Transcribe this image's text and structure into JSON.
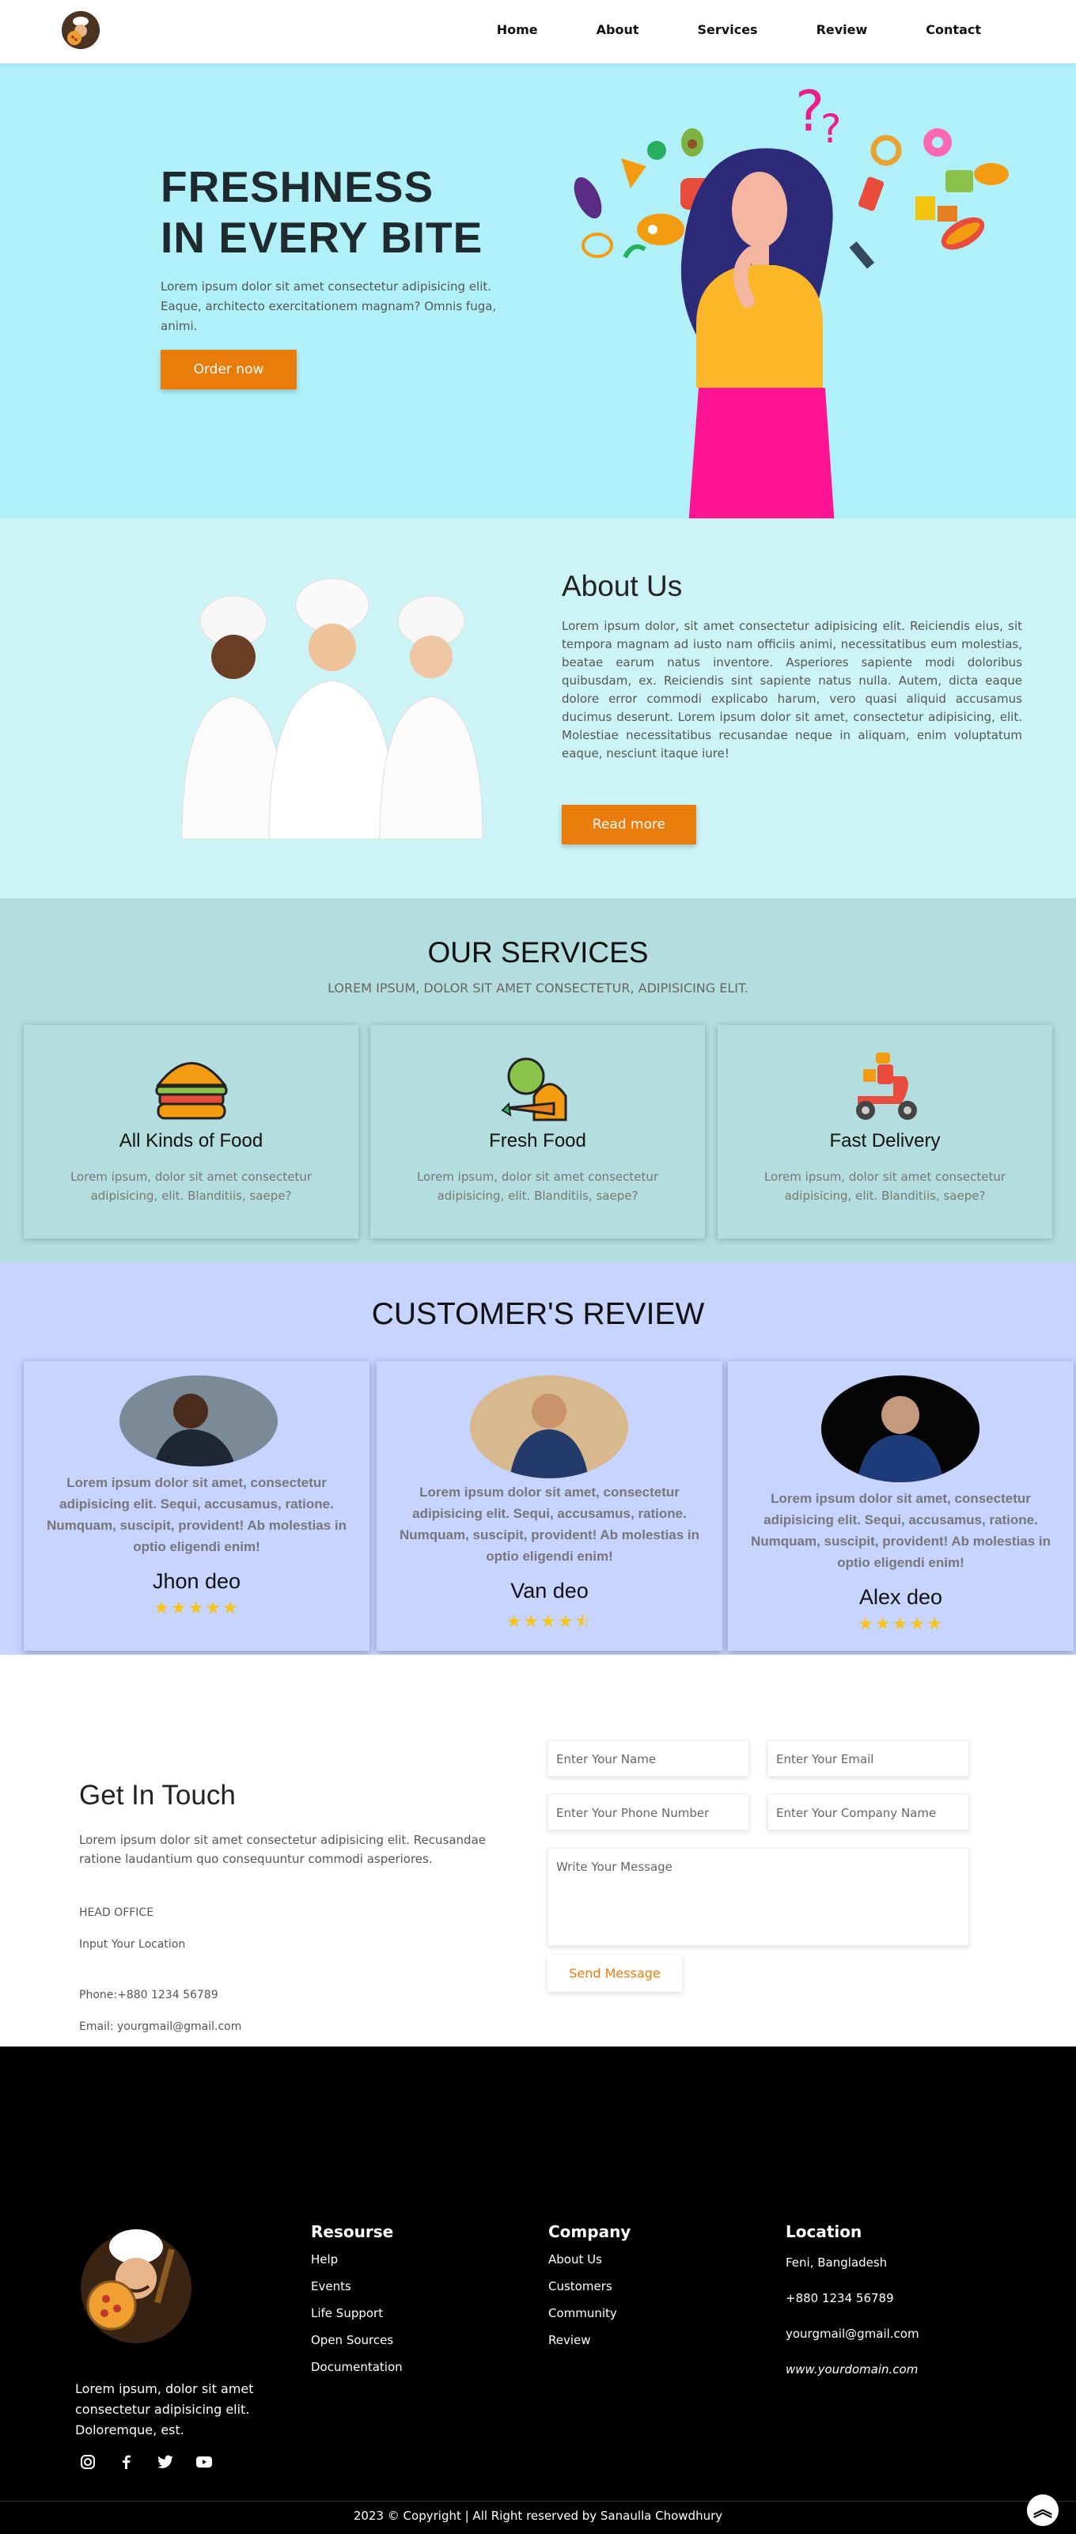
{
  "nav": {
    "logo": "chef-logo",
    "items": [
      {
        "label": "Home"
      },
      {
        "label": "About"
      },
      {
        "label": "Services"
      },
      {
        "label": "Review"
      },
      {
        "label": "Contact"
      }
    ]
  },
  "hero": {
    "title_line1": "FRESHNESS",
    "title_line2": "IN EVERY BITE",
    "text": "Lorem ipsum dolor sit amet consectetur adipisicing elit. Eaque, architecto exercitationem magnam? Omnis fuga, animi.",
    "button": "Order now",
    "bg_color": "#b0f1f9",
    "accent": "#ea7c0c"
  },
  "about": {
    "title": "About Us",
    "text": "Lorem ipsum dolor, sit amet consectetur adipisicing elit. Reiciendis eius, sit tempora magnam ad iusto nam officiis animi, necessitatibus eum molestias, beatae earum natus inventore. Asperiores sapiente modi doloribus quibusdam, ex. Reiciendis sint sapiente natus nulla. Autem, dicta eaque dolore error commodi explicabo harum, vero quasi aliquid accusamus ducimus deserunt. Lorem ipsum dolor sit amet, consectetur adipisicing, elit. Molestiae necessitatibus recusandae neque in aliquam, enim voluptatum eaque, nesciunt itaque iure!",
    "button": "Read more"
  },
  "services": {
    "title": "OUR SERVICES",
    "subtitle": "LOREM IPSUM, DOLOR SIT AMET CONSECTETUR, ADIPISICING ELIT.",
    "cards": [
      {
        "title": "All Kinds of Food",
        "icon": "burger-icon",
        "text": "Lorem ipsum, dolor sit amet consectetur adipisicing, elit. Blanditiis, saepe?"
      },
      {
        "title": "Fresh Food",
        "icon": "vegetables-icon",
        "text": "Lorem ipsum, dolor sit amet consectetur adipisicing, elit. Blanditiis, saepe?"
      },
      {
        "title": "Fast Delivery",
        "icon": "delivery-scooter-icon",
        "text": "Lorem ipsum, dolor sit amet consectetur adipisicing, elit. Blanditiis, saepe?"
      }
    ]
  },
  "reviews": {
    "title": "CUSTOMER'S REVIEW",
    "cards": [
      {
        "quote": "Lorem ipsum dolor sit amet, consectetur adipisicing elit. Sequi, accusamus, ratione. Numquam, suscipit, provident! Ab molestias in optio eligendi enim!",
        "name": "Jhon deo",
        "stars": "★★★★★",
        "rating": 5
      },
      {
        "quote": "Lorem ipsum dolor sit amet, consectetur adipisicing elit. Sequi, accusamus, ratione. Numquam, suscipit, provident! Ab molestias in optio eligendi enim!",
        "name": "Van deo",
        "stars": "★★★★⯪",
        "rating": 4.5
      },
      {
        "quote": "Lorem ipsum dolor sit amet, consectetur adipisicing elit. Sequi, accusamus, ratione. Numquam, suscipit, provident! Ab molestias in optio eligendi enim!",
        "name": "Alex deo",
        "stars": "★★★★★",
        "rating": 5
      }
    ]
  },
  "contact": {
    "title": "Get In Touch",
    "text": "Lorem ipsum dolor sit amet consectetur adipisicing elit. Recusandae ratione laudantium quo consequuntur commodi asperiores.",
    "head_office": "HEAD OFFICE",
    "location": "Input Your Location",
    "phone": "Phone:+880 1234 56789",
    "email": "Email: yourgmail@gmail.com",
    "form": {
      "name_placeholder": "Enter Your Name",
      "email_placeholder": "Enter Your Email",
      "phone_placeholder": "Enter Your Phone Number",
      "company_placeholder": "Enter Your Company Name",
      "message_placeholder": "Write Your Message",
      "send": "Send Message"
    }
  },
  "footer": {
    "about": "Lorem ipsum, dolor sit amet consectetur adipisicing elit. Doloremque, est.",
    "resource": {
      "title": "Resourse",
      "links": [
        "Help",
        "Events",
        "Life Support",
        "Open Sources",
        "Documentation"
      ]
    },
    "company": {
      "title": "Company",
      "links": [
        "About Us",
        "Customers",
        "Community",
        "Review"
      ]
    },
    "location": {
      "title": "Location",
      "lines": [
        "Feni, Bangladesh",
        "+880 1234 56789",
        "yourgmail@gmail.com",
        "www.yourdomain.com"
      ]
    },
    "copyright": "2023 © Copyright | All Right reserved by Sanaulla Chowdhury",
    "social": [
      "instagram-icon",
      "facebook-icon",
      "twitter-icon",
      "youtube-icon"
    ]
  }
}
